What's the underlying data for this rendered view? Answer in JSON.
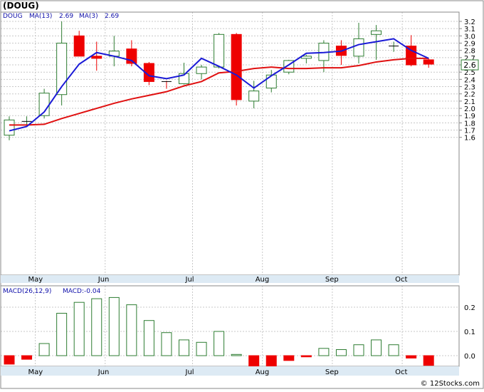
{
  "title": "(DOUG)",
  "watermark": "© 12Stocks.com",
  "legend": {
    "ticker": "DOUG",
    "ma13_label": "MA(13)",
    "ma13_value": "2.69",
    "ma3_label": "MA(3)",
    "ma3_value": "2.69"
  },
  "macd_legend": {
    "label": "MACD(26,12,9)",
    "value_label": "MACD:-0.04"
  },
  "colors": {
    "up": "#2e7d32",
    "down": "#ee0000",
    "ma13": "#1a1ad6",
    "ma3": "#e01010",
    "axis_band": "#ddeaf4",
    "grid": "#c8c8c8",
    "legend_text": "#1010aa",
    "last_price_box": "#2e7d32"
  },
  "last_price": "2.6",
  "x_labels": [
    "May",
    "Jun",
    "Jul",
    "Aug",
    "Sep",
    "Oct"
  ],
  "chart_data": [
    {
      "type": "candlestick",
      "title": "(DOUG)",
      "y_ticks": [
        1.6,
        1.7,
        1.8,
        1.9,
        2.0,
        2.1,
        2.2,
        2.3,
        2.4,
        2.5,
        2.6,
        2.7,
        2.8,
        2.9,
        3.0,
        3.1,
        3.2
      ],
      "ylim": [
        1.55,
        3.25
      ],
      "grid": true,
      "candles": [
        {
          "o": 1.63,
          "h": 1.89,
          "l": 1.56,
          "c": 1.84
        },
        {
          "o": 1.82,
          "h": 1.89,
          "l": 1.76,
          "c": 1.82
        },
        {
          "o": 1.9,
          "h": 2.27,
          "l": 1.86,
          "c": 2.21
        },
        {
          "o": 2.19,
          "h": 3.2,
          "l": 2.04,
          "c": 2.9
        },
        {
          "o": 3.0,
          "h": 3.07,
          "l": 2.72,
          "c": 2.72
        },
        {
          "o": 2.72,
          "h": 2.92,
          "l": 2.52,
          "c": 2.69
        },
        {
          "o": 2.72,
          "h": 3.0,
          "l": 2.58,
          "c": 2.79
        },
        {
          "o": 2.82,
          "h": 2.94,
          "l": 2.58,
          "c": 2.62
        },
        {
          "o": 2.62,
          "h": 2.64,
          "l": 2.32,
          "c": 2.37
        },
        {
          "o": 2.37,
          "h": 2.38,
          "l": 2.27,
          "c": 2.36
        },
        {
          "o": 2.34,
          "h": 2.63,
          "l": 2.33,
          "c": 2.48
        },
        {
          "o": 2.48,
          "h": 2.6,
          "l": 2.4,
          "c": 2.57
        },
        {
          "o": 2.57,
          "h": 3.04,
          "l": 2.55,
          "c": 3.02
        },
        {
          "o": 3.02,
          "h": 3.04,
          "l": 2.04,
          "c": 2.12
        },
        {
          "o": 2.1,
          "h": 2.38,
          "l": 2.0,
          "c": 2.24
        },
        {
          "o": 2.28,
          "h": 2.53,
          "l": 2.22,
          "c": 2.46
        },
        {
          "o": 2.5,
          "h": 2.67,
          "l": 2.47,
          "c": 2.66
        },
        {
          "o": 2.69,
          "h": 2.74,
          "l": 2.62,
          "c": 2.72
        },
        {
          "o": 2.66,
          "h": 2.94,
          "l": 2.5,
          "c": 2.9
        },
        {
          "o": 2.86,
          "h": 2.94,
          "l": 2.6,
          "c": 2.73
        },
        {
          "o": 2.72,
          "h": 3.18,
          "l": 2.62,
          "c": 2.96
        },
        {
          "o": 3.02,
          "h": 3.15,
          "l": 2.67,
          "c": 3.07
        },
        {
          "o": 2.86,
          "h": 2.92,
          "l": 2.78,
          "c": 2.86
        },
        {
          "o": 2.86,
          "h": 3.01,
          "l": 2.58,
          "c": 2.6
        },
        {
          "o": 2.67,
          "h": 2.69,
          "l": 2.56,
          "c": 2.61
        }
      ],
      "ma13": [
        1.69,
        1.75,
        1.95,
        2.3,
        2.61,
        2.77,
        2.72,
        2.66,
        2.45,
        2.41,
        2.46,
        2.69,
        2.58,
        2.46,
        2.28,
        2.45,
        2.6,
        2.76,
        2.77,
        2.79,
        2.88,
        2.92,
        2.96,
        2.8,
        2.69
      ],
      "ma3": [
        1.77,
        1.77,
        1.78,
        1.86,
        1.93,
        2.0,
        2.07,
        2.13,
        2.18,
        2.23,
        2.31,
        2.37,
        2.49,
        2.51,
        2.55,
        2.57,
        2.55,
        2.55,
        2.56,
        2.56,
        2.59,
        2.64,
        2.67,
        2.69,
        2.69
      ],
      "month_start_index": [
        1,
        5,
        10,
        14,
        18,
        22
      ]
    },
    {
      "type": "bar",
      "title": "MACD(26,12,9)",
      "y_ticks": [
        0.0,
        0.1,
        0.2
      ],
      "ylim": [
        -0.05,
        0.26
      ],
      "values": [
        -0.035,
        -0.015,
        0.05,
        0.175,
        0.22,
        0.235,
        0.24,
        0.21,
        0.145,
        0.095,
        0.065,
        0.055,
        0.1,
        0.005,
        -0.055,
        -0.05,
        -0.02,
        -0.005,
        0.03,
        0.025,
        0.045,
        0.065,
        0.045,
        -0.01,
        -0.04
      ]
    }
  ]
}
